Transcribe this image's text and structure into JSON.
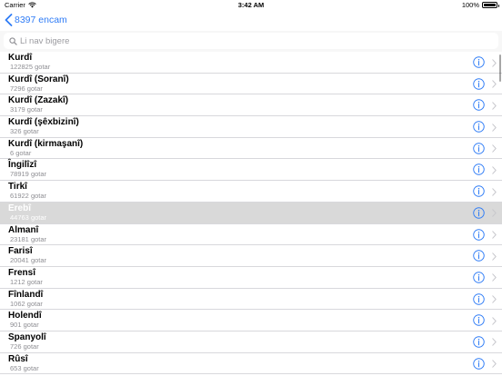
{
  "status_bar": {
    "carrier": "Carrier",
    "time": "3:42 AM",
    "battery": "100%",
    "wifi_icon": "wifi-icon",
    "battery_icon": "battery-icon"
  },
  "nav": {
    "back_label": "8397 encam",
    "back_icon": "chevron-left-icon",
    "accent_color": "#2f7cf6"
  },
  "search": {
    "placeholder": "Li nav bigere",
    "value": ""
  },
  "rows": [
    {
      "title": "Kurdî",
      "subtitle": "122825 gotar",
      "selected": false
    },
    {
      "title": "Kurdî (Soranî)",
      "subtitle": "7296 gotar",
      "selected": false
    },
    {
      "title": "Kurdî (Zazakî)",
      "subtitle": "3179 gotar",
      "selected": false
    },
    {
      "title": "Kurdî (şêxbizinî)",
      "subtitle": "326 gotar",
      "selected": false
    },
    {
      "title": "Kurdî (kirmaşanî)",
      "subtitle": "6 gotar",
      "selected": false
    },
    {
      "title": "Îngilîzî",
      "subtitle": "78919 gotar",
      "selected": false
    },
    {
      "title": "Tirkî",
      "subtitle": "61922 gotar",
      "selected": false
    },
    {
      "title": "Erebî",
      "subtitle": "44763 gotar",
      "selected": true
    },
    {
      "title": "Almanî",
      "subtitle": "23181 gotar",
      "selected": false
    },
    {
      "title": "Farisî",
      "subtitle": "20041 gotar",
      "selected": false
    },
    {
      "title": "Frensî",
      "subtitle": "1212 gotar",
      "selected": false
    },
    {
      "title": "Fînlandî",
      "subtitle": "1062 gotar",
      "selected": false
    },
    {
      "title": "Holendî",
      "subtitle": "901 gotar",
      "selected": false
    },
    {
      "title": "Spanyolî",
      "subtitle": "726 gotar",
      "selected": false
    },
    {
      "title": "Rûsî",
      "subtitle": "653 gotar",
      "selected": false
    }
  ],
  "row_icons": {
    "info": "info-icon",
    "disclosure": "chevron-right-icon"
  },
  "colors": {
    "selected_row": "#d9d9d9",
    "info_icon": "#2f7cf6",
    "separator": "#d8d8dc"
  }
}
